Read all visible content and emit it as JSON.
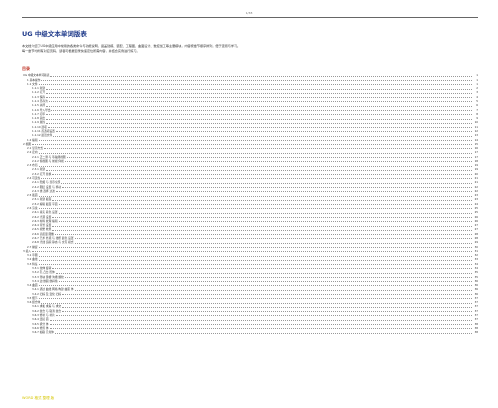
{
  "header": {
    "page_number": "1/38"
  },
  "document": {
    "title": "UG 中级文本单词版表",
    "intro_lines": [
      "本文档介绍了UG中级应用中常用的各类命令与功能说明，涵盖建模、装配、工程图、曲面设计、数控加工等主要模块，内容按章节顺序排列，便于查阅与学习。",
      "每一章节均附有对应页码，读者可根据目录快速定位所需内容，并结合实例进行练习。"
    ],
    "toc_heading": "目录"
  },
  "toc": [
    {
      "level": 1,
      "label": "UG 中级文本单词版表",
      "page": "1"
    },
    {
      "level": 2,
      "label": "1 基本操作",
      "page": "1"
    },
    {
      "level": 2,
      "label": "1.1 文件",
      "page": "1"
    },
    {
      "level": 3,
      "label": "1.1.1 新建",
      "page": "2"
    },
    {
      "level": 3,
      "label": "1.1.2 打开",
      "page": "3"
    },
    {
      "level": 3,
      "label": "1.1.3 保存",
      "page": "4"
    },
    {
      "level": 3,
      "label": "1.1.4 另存为",
      "page": "5"
    },
    {
      "level": 3,
      "label": "1.1.5 关闭",
      "page": "6"
    },
    {
      "level": 3,
      "label": "1.1.6 导入导出",
      "page": "7"
    },
    {
      "level": 3,
      "label": "1.1.7 打印",
      "page": "8"
    },
    {
      "level": 3,
      "label": "1.1.8 退出",
      "page": "9"
    },
    {
      "level": 3,
      "label": "1.1.9 属性",
      "page": "10"
    },
    {
      "level": 3,
      "label": "1.1.10 选项",
      "page": "11"
    },
    {
      "level": 3,
      "label": "1.1.11 首选项设置",
      "page": "12"
    },
    {
      "level": 3,
      "label": "1.1.12 最近文件",
      "page": "13"
    },
    {
      "level": 2,
      "label": "1.2 编辑",
      "page": "14"
    },
    {
      "level": 1,
      "label": "2 视图",
      "page": "15"
    },
    {
      "level": 2,
      "label": "2.1 显示方式",
      "page": "16"
    },
    {
      "level": 2,
      "label": "2.2 定向",
      "page": "17"
    },
    {
      "level": 3,
      "label": "2.2.1 正二测 与 等轴测视图",
      "page": "17"
    },
    {
      "level": 3,
      "label": "2.2.2 俯视图 与 前视 仰视",
      "page": "18"
    },
    {
      "level": 2,
      "label": "2.3 布局",
      "page": "19"
    },
    {
      "level": 3,
      "label": "2.3.1 新建",
      "page": "19"
    },
    {
      "level": 3,
      "label": "2.3.2 打开 替换",
      "page": "20"
    },
    {
      "level": 2,
      "label": "2.4 可见性",
      "page": "21"
    },
    {
      "level": 3,
      "label": "2.4.1 隐藏 与 显示全部",
      "page": "21"
    },
    {
      "level": 3,
      "label": "2.4.2 图层 设置 与 移动",
      "page": "22"
    },
    {
      "level": 3,
      "label": "2.4.3 类 选择 过滤",
      "page": "22"
    },
    {
      "level": 2,
      "label": "2.5 截面",
      "page": "23"
    },
    {
      "level": 3,
      "label": "2.5.1 新建 截面",
      "page": "23"
    },
    {
      "level": 3,
      "label": "2.5.2 编辑 截面 平面",
      "page": "24"
    },
    {
      "level": 2,
      "label": "2.6 渲染",
      "page": "25"
    },
    {
      "level": 3,
      "label": "2.6.1 真实 着色 设置",
      "page": "25"
    },
    {
      "level": 3,
      "label": "2.6.2 光源 设置",
      "page": "26"
    },
    {
      "level": 3,
      "label": "2.6.3 材料 纹理 编辑",
      "page": "26"
    },
    {
      "level": 3,
      "label": "2.6.4 背景 设置",
      "page": "27"
    },
    {
      "level": 3,
      "label": "2.6.5 视觉 效果",
      "page": "27"
    },
    {
      "level": 3,
      "label": "2.6.6 高质量 图像",
      "page": "28"
    },
    {
      "level": 3,
      "label": "2.6.7 艺术 外观 与 线框 颜色 设置",
      "page": "28"
    },
    {
      "level": 3,
      "label": "2.6.8 光线 追踪 静态 与 交互 模式",
      "page": "29"
    },
    {
      "level": 2,
      "label": "2.7 捕捉",
      "page": "30"
    },
    {
      "level": 1,
      "label": "3 插入",
      "page": "31"
    },
    {
      "level": 2,
      "label": "3.1 草图",
      "page": "32"
    },
    {
      "level": 2,
      "label": "3.2 曲线",
      "page": "33"
    },
    {
      "level": 2,
      "label": "3.3 特征",
      "page": "34"
    },
    {
      "level": 3,
      "label": "3.3.1 拉伸 旋转",
      "page": "34"
    },
    {
      "level": 3,
      "label": "3.3.2 孔 凸台 腔体",
      "page": "35"
    },
    {
      "level": 3,
      "label": "3.3.3 垫块 键槽 沟槽 螺纹",
      "page": "35"
    },
    {
      "level": 3,
      "label": "3.3.4 边 倒圆 倒斜角",
      "page": "36"
    },
    {
      "level": 2,
      "label": "3.4 曲面",
      "page": "36"
    },
    {
      "level": 3,
      "label": "3.4.1 通过 曲线 网格 构建 曲面 体",
      "page": "36"
    },
    {
      "level": 3,
      "label": "3.4.2 扫掠 及 变化 扫掠",
      "page": "36"
    },
    {
      "level": 2,
      "label": "3.5 细节",
      "page": "37"
    },
    {
      "level": 2,
      "label": "3.6 组合体",
      "page": "37"
    },
    {
      "level": 3,
      "label": "3.6.1 求和 求差 与 求交",
      "page": "37"
    },
    {
      "level": 3,
      "label": "3.6.2 缝合 与 取消 缝合",
      "page": "37"
    },
    {
      "level": 3,
      "label": "3.6.3 修补 与 补片",
      "page": "37"
    },
    {
      "level": 3,
      "label": "3.6.4 连接 面",
      "page": "37"
    },
    {
      "level": 3,
      "label": "3.6.5 拆分 体",
      "page": "38"
    },
    {
      "level": 3,
      "label": "3.6.6 修剪 体",
      "page": "38"
    },
    {
      "level": 3,
      "label": "3.6.7 抽取 几何体",
      "page": "38"
    }
  ],
  "footer": {
    "mark": "WORD 格式 整理 版"
  }
}
